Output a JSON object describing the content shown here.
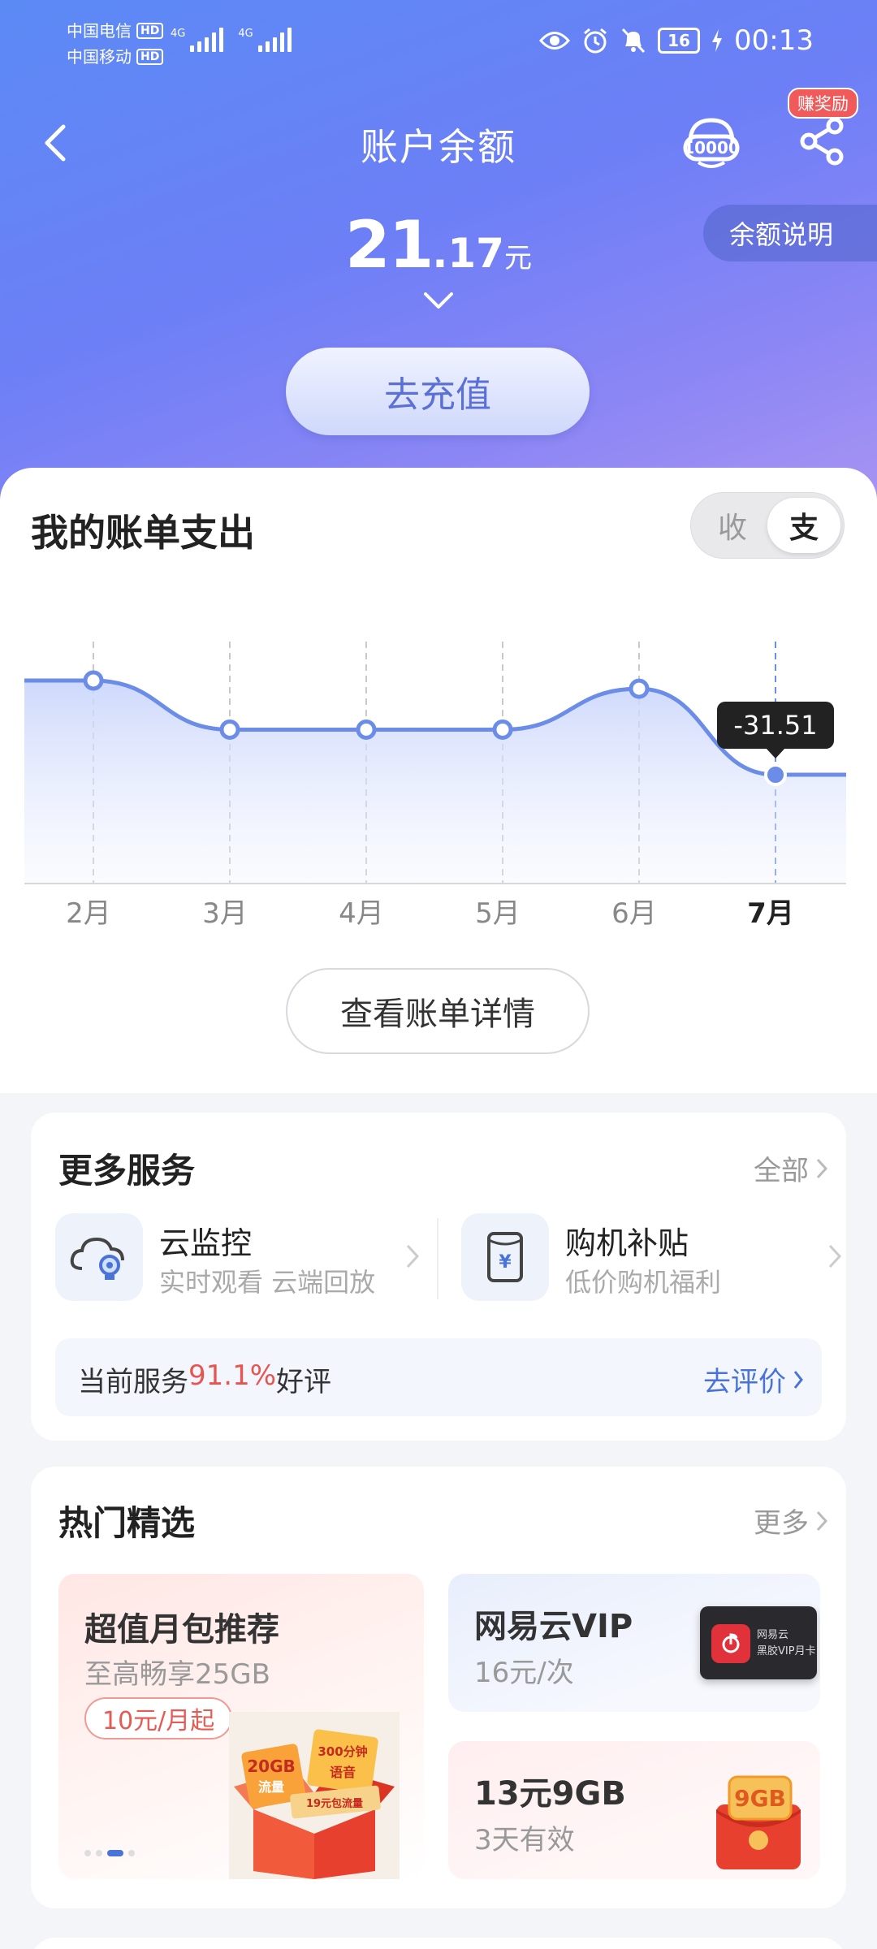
{
  "status_bar": {
    "carrier1": "中国电信",
    "carrier2": "中国移动",
    "hd_label": "HD",
    "net1": "4G",
    "net2": "4G",
    "battery": "16",
    "time": "00:13"
  },
  "header": {
    "title": "账户余额",
    "reward_badge": "赚奖励",
    "balance_desc_button": "余额说明",
    "balance_int": "21",
    "balance_dec": ".17",
    "balance_unit": "元",
    "recharge_button": "去充值",
    "service_icon": "customer-service-10000-icon",
    "share_icon": "share-icon",
    "theme_color": "#5b8af5"
  },
  "bill": {
    "title": "我的账单支出",
    "toggle_in": "收",
    "toggle_out": "支",
    "detail_button": "查看账单详情"
  },
  "chart_data": {
    "type": "area",
    "categories": [
      "2月",
      "3月",
      "4月",
      "5月",
      "6月",
      "7月"
    ],
    "values": [
      -20,
      -26,
      -26,
      -26,
      -21,
      -31.51
    ],
    "highlight_index": 5,
    "highlight_label": "-31.51",
    "line_color": "#6b8de8",
    "grid": "vertical dashed"
  },
  "services": {
    "title": "更多服务",
    "all_link": "全部",
    "items": [
      {
        "name": "云监控",
        "desc": "实时观看 云端回放",
        "icon": "cloud-camera-icon"
      },
      {
        "name": "购机补贴",
        "desc": "低价购机福利",
        "icon": "phone-subsidy-icon"
      }
    ],
    "rating_prefix": "当前服务",
    "rating_value": "91.1%",
    "rating_suffix": "好评",
    "rate_link": "去评价"
  },
  "hot": {
    "title": "热门精选",
    "more_link": "更多",
    "main": {
      "title": "超值月包推荐",
      "sub": "至高畅享25GB",
      "tag": "10元/月起",
      "box_label1": "20GB",
      "box_label2": "流量",
      "box_label3": "300分钟",
      "box_label4": "语音",
      "box_label5": "19元包流量"
    },
    "vip": {
      "title": "网易云VIP",
      "sub": "16元/次",
      "card_line1": "网易云",
      "card_line2": "黑胶VIP月卡"
    },
    "data_pack": {
      "title": "13元9GB",
      "sub": "3天有效",
      "badge": "9GB"
    }
  }
}
